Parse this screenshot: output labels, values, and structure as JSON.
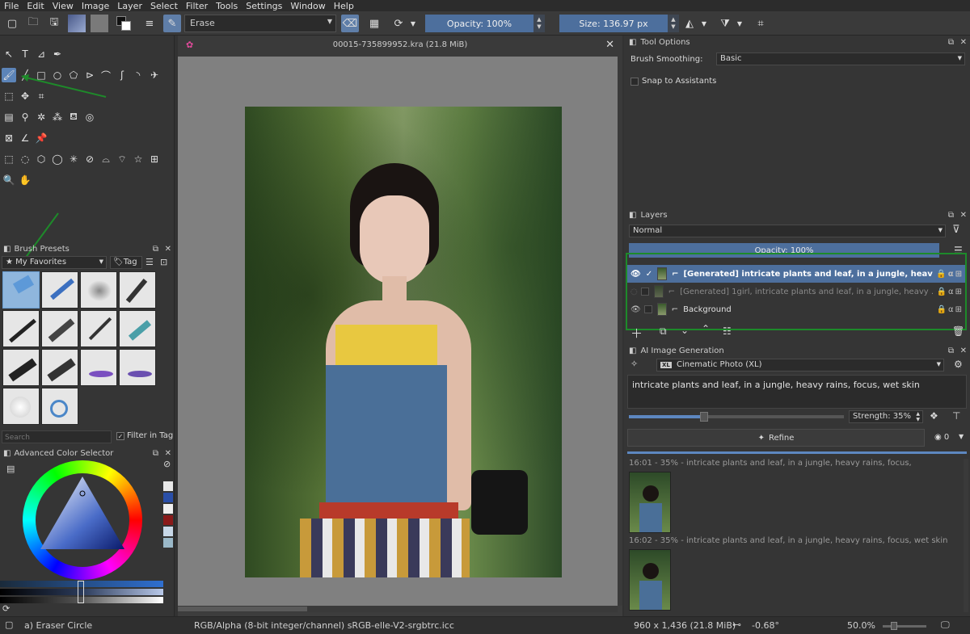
{
  "menu": [
    "File",
    "Edit",
    "View",
    "Image",
    "Layer",
    "Select",
    "Filter",
    "Tools",
    "Settings",
    "Window",
    "Help"
  ],
  "toolbar": {
    "blend_mode": "Erase",
    "opacity_label": "Opacity: 100%",
    "size_label": "Size: 136.97 px"
  },
  "document": {
    "title": "00015-735899952.kra (21.8 MiB)"
  },
  "brush_presets": {
    "title": "Brush Presets",
    "tag_filter": "★ My Favorites",
    "tag_label": "Tag",
    "search_placeholder": "Search",
    "filter_in_tag": "Filter in Tag"
  },
  "color_selector": {
    "title": "Advanced Color Selector"
  },
  "tool_options": {
    "title": "Tool Options",
    "brush_smoothing_label": "Brush Smoothing:",
    "brush_smoothing_value": "Basic",
    "snap_label": "Snap to Assistants"
  },
  "layers": {
    "title": "Layers",
    "blend": "Normal",
    "opacity": "Opacity: 100%",
    "items": [
      {
        "name": "[Generated] intricate plants and leaf, in a jungle, heav..."
      },
      {
        "name": "[Generated] 1girl, intricate plants and leaf, in a jungle, heavy ..."
      },
      {
        "name": "Background"
      }
    ]
  },
  "ai_generation": {
    "title": "AI Image Generation",
    "style": "Cinematic Photo (XL)",
    "style_badge": "XL",
    "prompt": "intricate plants and leaf, in a jungle, heavy rains, focus, wet skin",
    "strength_label": "Strength: 35%",
    "strength": 0.35,
    "refine_label": "Refine",
    "count": "0",
    "history": [
      {
        "caption": "16:01 - 35% - intricate plants and leaf, in a jungle, heavy rains, focus,"
      },
      {
        "caption": "16:02 - 35% - intricate plants and leaf, in a jungle, heavy rains, focus, wet skin"
      }
    ]
  },
  "status": {
    "brush": "a) Eraser Circle",
    "colorspace": "RGB/Alpha (8-bit integer/channel)  sRGB-elle-V2-srgbtrc.icc",
    "dimensions": "960 x 1,436 (21.8 MiB)",
    "rotation": "-0.68°",
    "zoom": "50.0%"
  }
}
